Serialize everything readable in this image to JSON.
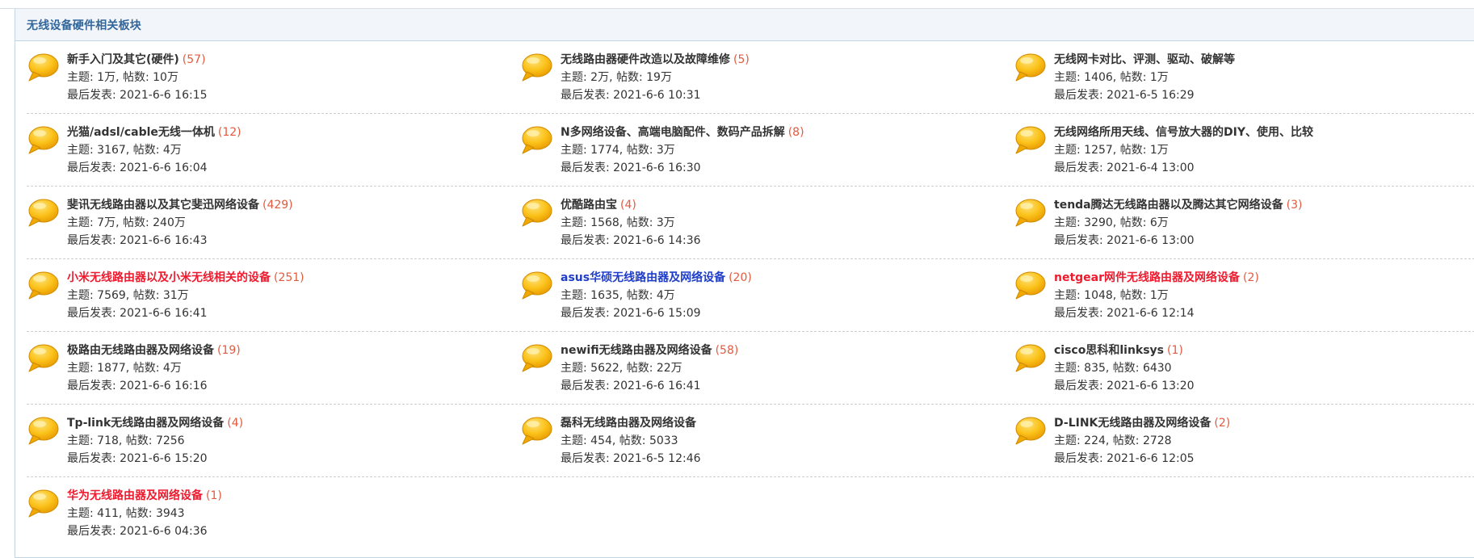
{
  "section": {
    "title": "无线设备硬件相关板块"
  },
  "colors": {
    "header_bg": "#f2f6fa",
    "header_text": "#336699",
    "border": "#c2d5e3",
    "count": "#e25a3f",
    "highlight_red": "#ee1b2e",
    "highlight_blue": "#1f3dc9",
    "bubble": "#f8b800"
  },
  "icons": {
    "forum": "speech-bubble-icon"
  },
  "forums": [
    {
      "name": "新手入门及其它(硬件)",
      "count": "(57)",
      "stats": "主题: 1万, 帖数: 10万",
      "last": "最后发表: 2021-6-6 16:15",
      "color": "default"
    },
    {
      "name": "无线路由器硬件改造以及故障维修",
      "count": "(5)",
      "stats": "主题: 2万, 帖数: 19万",
      "last": "最后发表: 2021-6-6 10:31",
      "color": "default"
    },
    {
      "name": "无线网卡对比、评测、驱动、破解等",
      "count": "",
      "stats": "主题: 1406, 帖数: 1万",
      "last": "最后发表: 2021-6-5 16:29",
      "color": "default"
    },
    {
      "name": "光猫/adsl/cable无线一体机",
      "count": "(12)",
      "stats": "主题: 3167, 帖数: 4万",
      "last": "最后发表: 2021-6-6 16:04",
      "color": "default"
    },
    {
      "name": "N多网络设备、高端电脑配件、数码产品拆解",
      "count": "(8)",
      "stats": "主题: 1774, 帖数: 3万",
      "last": "最后发表: 2021-6-6 16:30",
      "color": "default"
    },
    {
      "name": "无线网络所用天线、信号放大器的DIY、使用、比较",
      "count": "",
      "stats": "主题: 1257, 帖数: 1万",
      "last": "最后发表: 2021-6-4 13:00",
      "color": "default"
    },
    {
      "name": "斐讯无线路由器以及其它斐迅网络设备",
      "count": "(429)",
      "stats": "主题: 7万, 帖数: 240万",
      "last": "最后发表: 2021-6-6 16:43",
      "color": "default"
    },
    {
      "name": "优酷路由宝",
      "count": "(4)",
      "stats": "主题: 1568, 帖数: 3万",
      "last": "最后发表: 2021-6-6 14:36",
      "color": "default"
    },
    {
      "name": "tenda腾达无线路由器以及腾达其它网络设备",
      "count": "(3)",
      "stats": "主题: 3290, 帖数: 6万",
      "last": "最后发表: 2021-6-6 13:00",
      "color": "default"
    },
    {
      "name": "小米无线路由器以及小米无线相关的设备",
      "count": "(251)",
      "stats": "主题: 7569, 帖数: 31万",
      "last": "最后发表: 2021-6-6 16:41",
      "color": "red"
    },
    {
      "name": "asus华硕无线路由器及网络设备",
      "count": "(20)",
      "stats": "主题: 1635, 帖数: 4万",
      "last": "最后发表: 2021-6-6 15:09",
      "color": "blue"
    },
    {
      "name": "netgear网件无线路由器及网络设备",
      "count": "(2)",
      "stats": "主题: 1048, 帖数: 1万",
      "last": "最后发表: 2021-6-6 12:14",
      "color": "red"
    },
    {
      "name": "极路由无线路由器及网络设备",
      "count": "(19)",
      "stats": "主题: 1877, 帖数: 4万",
      "last": "最后发表: 2021-6-6 16:16",
      "color": "default"
    },
    {
      "name": "newifi无线路由器及网络设备",
      "count": "(58)",
      "stats": "主题: 5622, 帖数: 22万",
      "last": "最后发表: 2021-6-6 16:41",
      "color": "default"
    },
    {
      "name": "cisco思科和linksys",
      "count": "(1)",
      "stats": "主题: 835, 帖数: 6430",
      "last": "最后发表: 2021-6-6 13:20",
      "color": "default"
    },
    {
      "name": "Tp-link无线路由器及网络设备",
      "count": "(4)",
      "stats": "主题: 718, 帖数: 7256",
      "last": "最后发表: 2021-6-6 15:20",
      "color": "default"
    },
    {
      "name": "磊科无线路由器及网络设备",
      "count": "",
      "stats": "主题: 454, 帖数: 5033",
      "last": "最后发表: 2021-6-5 12:46",
      "color": "default"
    },
    {
      "name": "D-LINK无线路由器及网络设备",
      "count": "(2)",
      "stats": "主题: 224, 帖数: 2728",
      "last": "最后发表: 2021-6-6 12:05",
      "color": "default"
    },
    {
      "name": "华为无线路由器及网络设备",
      "count": "(1)",
      "stats": "主题: 411, 帖数: 3943",
      "last": "最后发表: 2021-6-6 04:36",
      "color": "red"
    }
  ]
}
